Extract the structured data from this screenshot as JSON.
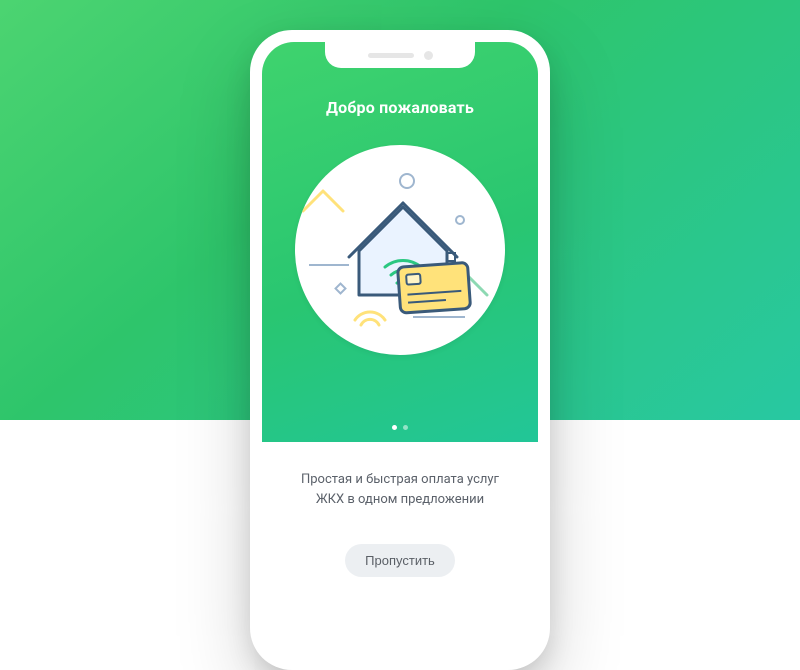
{
  "hero": {
    "title": "Добро пожаловать"
  },
  "illustration_name": "house-credit-card-icon",
  "colors": {
    "brand_gradient_start": "#3fd36e",
    "brand_gradient_mid": "#29c671",
    "brand_gradient_end": "#22c698",
    "skip_bg": "#eceff2",
    "stroke": "#3a5a7a",
    "house_fill": "#eaf3ff",
    "card_fill": "#ffe27a",
    "accent_circle": "#2bc781",
    "small_shape": "#8dd9b3"
  },
  "pager": {
    "total": 2,
    "active_index": 0
  },
  "content": {
    "line1": "Простая и быстрая оплата услуг",
    "line2": "ЖКХ в одном предложении"
  },
  "actions": {
    "skip_label": "Пропустить"
  }
}
